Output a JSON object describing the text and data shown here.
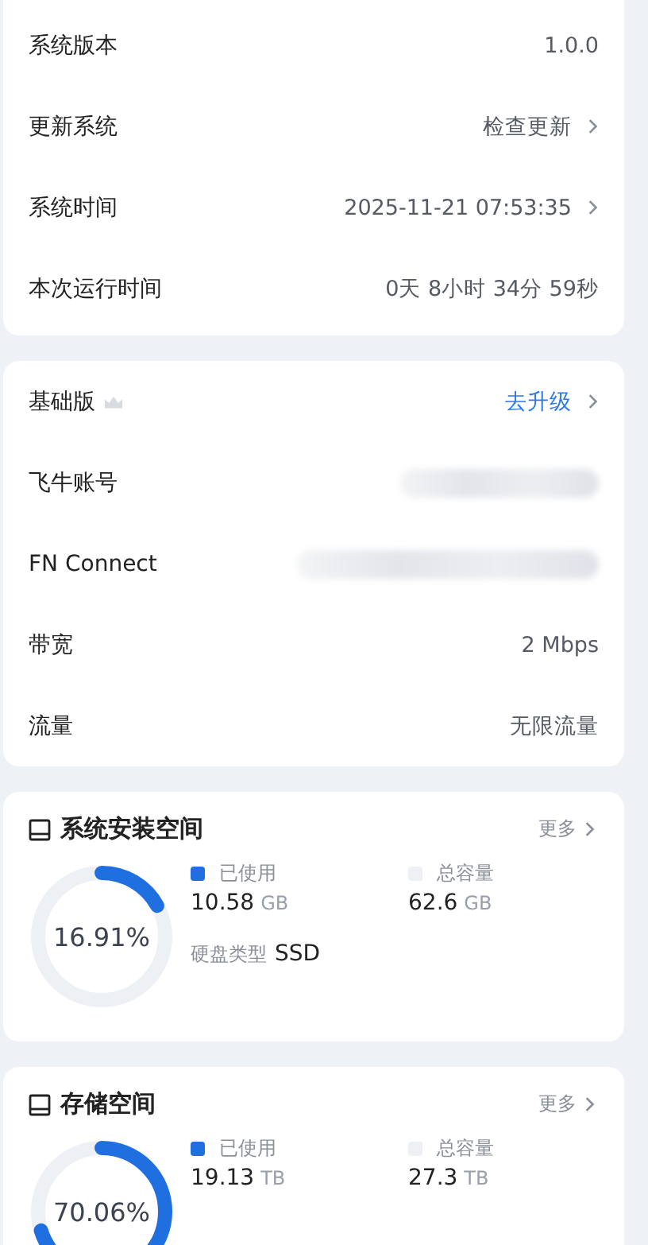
{
  "system_card": {
    "rows": [
      {
        "label": "系统版本",
        "value": "1.0.0",
        "chevron": false
      },
      {
        "label": "更新系统",
        "value": "检查更新",
        "chevron": true
      },
      {
        "label": "系统时间",
        "value": "2025-11-21 07:53:35",
        "chevron": true
      },
      {
        "label": "本次运行时间",
        "value": "0天 8小时 34分 59秒",
        "chevron": false
      }
    ]
  },
  "account_card": {
    "rows": [
      {
        "kind": "plan",
        "label": "基础版",
        "value": "去升级",
        "chevron": true
      },
      {
        "kind": "blurred",
        "label": "飞牛账号"
      },
      {
        "kind": "blurred",
        "label": "FN Connect"
      },
      {
        "kind": "text",
        "label": "带宽",
        "value": "2 Mbps"
      },
      {
        "kind": "text",
        "label": "流量",
        "value": "无限流量"
      }
    ]
  },
  "storage_cards": [
    {
      "title": "系统安装空间",
      "more": "更多",
      "percent": "16.91%",
      "used_label": "已使用",
      "used": "10.58",
      "used_unit": "GB",
      "total_label": "总容量",
      "total": "62.6",
      "total_unit": "GB",
      "extras": [
        {
          "label": "硬盘类型",
          "value": "SSD"
        }
      ]
    },
    {
      "title": "存储空间",
      "more": "更多",
      "percent": "70.06%",
      "used_label": "已使用",
      "used": "19.13",
      "used_unit": "TB",
      "total_label": "总容量",
      "total": "27.3",
      "total_unit": "TB"
    }
  ]
}
